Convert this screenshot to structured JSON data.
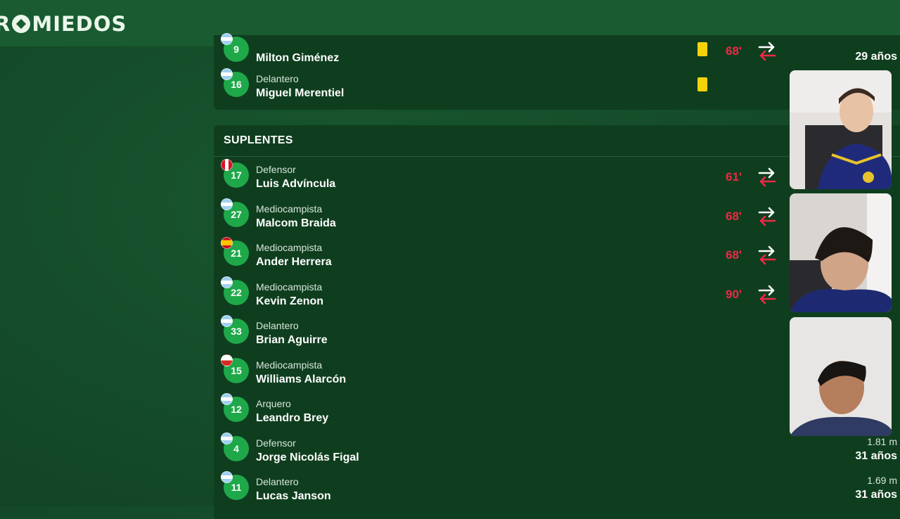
{
  "brand": {
    "prefix": "R",
    "rest": "MIEDOS"
  },
  "starters_tail": [
    {
      "number": "9",
      "position": "",
      "name": "Milton Giménez",
      "minute": "68'",
      "yellow_card": true,
      "flag": "arg",
      "right_top": "",
      "right_bottom": "29 años"
    },
    {
      "number": "16",
      "position": "Delantero",
      "name": "Miguel Merentiel",
      "minute": "",
      "yellow_card": true,
      "flag": "arg",
      "right_top": "",
      "right_bottom": ""
    }
  ],
  "subs_title": "SUPLENTES",
  "subs": [
    {
      "number": "17",
      "position": "Defensor",
      "name": "Luis Advíncula",
      "minute": "61'",
      "flag": "per",
      "right_top": "",
      "right_bottom": ""
    },
    {
      "number": "27",
      "position": "Mediocampista",
      "name": "Malcom Braida",
      "minute": "68'",
      "flag": "arg",
      "right_top": "",
      "right_bottom": ""
    },
    {
      "number": "21",
      "position": "Mediocampista",
      "name": "Ander Herrera",
      "minute": "68'",
      "flag": "esp",
      "right_top": "",
      "right_bottom": ""
    },
    {
      "number": "22",
      "position": "Mediocampista",
      "name": "Kevin Zenon",
      "minute": "90'",
      "flag": "arg",
      "right_top": "",
      "right_bottom": ""
    },
    {
      "number": "33",
      "position": "Delantero",
      "name": "Brian Aguirre",
      "minute": "",
      "flag": "arg",
      "right_top": "",
      "right_bottom": ""
    },
    {
      "number": "15",
      "position": "Mediocampista",
      "name": "Williams Alarcón",
      "minute": "",
      "flag": "chi",
      "right_top": "",
      "right_bottom": ""
    },
    {
      "number": "12",
      "position": "Arquero",
      "name": "Leandro Brey",
      "minute": "",
      "flag": "arg",
      "right_top": "",
      "right_bottom": ""
    },
    {
      "number": "4",
      "position": "Defensor",
      "name": "Jorge Nicolás Figal",
      "minute": "",
      "flag": "arg",
      "right_top": "1.81 m",
      "right_bottom": "31 años"
    },
    {
      "number": "11",
      "position": "Delantero",
      "name": "Lucas Janson",
      "minute": "",
      "flag": "arg",
      "right_top": "1.69 m",
      "right_bottom": "31 años"
    }
  ],
  "colors": {
    "background": "#154d2a",
    "panel": "#0f3e1f",
    "number_badge": "#1fa84a",
    "minute": "#ec2a45",
    "yellow_card": "#f5d30b"
  },
  "icons": {
    "substitution": "swap-arrows-icon",
    "logo_ball": "soccer-ball-icon"
  }
}
